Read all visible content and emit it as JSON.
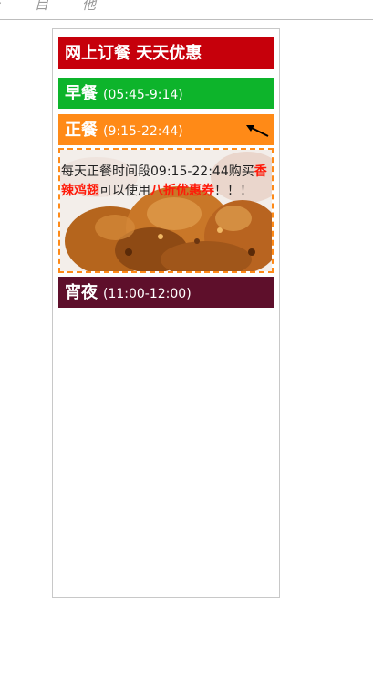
{
  "toolbar": {
    "glyph_left": "‹",
    "glyph_mid": "目",
    "glyph_right": "他"
  },
  "header": {
    "title": "网上订餐 天天优惠"
  },
  "meals": [
    {
      "name": "早餐",
      "time": "(05:45-9:14)",
      "color": "#0db42b"
    },
    {
      "name": "正餐",
      "time": "(9:15-22:44)",
      "color": "#ff8a17"
    },
    {
      "name": "宵夜",
      "time": "(11:00-12:00)",
      "color": "#5e0f2b"
    }
  ],
  "promo": {
    "text_part1": "每天正餐时间段09:15-22:44购买",
    "highlight1": "香辣鸡翅",
    "text_part2": "可以使用",
    "highlight2": "八折优惠券",
    "text_part3": "！！！"
  },
  "colors": {
    "title_bg": "#c6000b",
    "highlight": "#ff1a0a",
    "dashed_border": "#ff8a17"
  }
}
